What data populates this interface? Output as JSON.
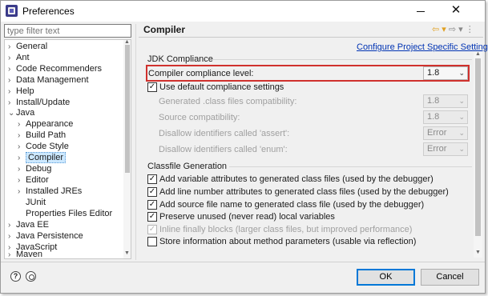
{
  "window": {
    "title": "Preferences",
    "minimize_label": "—",
    "close_label": "✕"
  },
  "filter": {
    "placeholder": "type filter text"
  },
  "tree": {
    "items": [
      {
        "label": "General",
        "chevron": "›"
      },
      {
        "label": "Ant",
        "chevron": "›"
      },
      {
        "label": "Code Recommenders",
        "chevron": "›"
      },
      {
        "label": "Data Management",
        "chevron": "›"
      },
      {
        "label": "Help",
        "chevron": "›"
      },
      {
        "label": "Install/Update",
        "chevron": "›"
      },
      {
        "label": "Java",
        "chevron": "⌄"
      },
      {
        "label": "Appearance",
        "chevron": "›"
      },
      {
        "label": "Build Path",
        "chevron": "›"
      },
      {
        "label": "Code Style",
        "chevron": "›"
      },
      {
        "label": "Compiler",
        "chevron": "›"
      },
      {
        "label": "Debug",
        "chevron": "›"
      },
      {
        "label": "Editor",
        "chevron": "›"
      },
      {
        "label": "Installed JREs",
        "chevron": "›"
      },
      {
        "label": "JUnit",
        "chevron": ""
      },
      {
        "label": "Properties Files Editor",
        "chevron": ""
      },
      {
        "label": "Java EE",
        "chevron": "›"
      },
      {
        "label": "Java Persistence",
        "chevron": "›"
      },
      {
        "label": "JavaScript",
        "chevron": "›"
      },
      {
        "label": "Maven",
        "chevron": "›"
      }
    ],
    "selected": "Compiler"
  },
  "page": {
    "title": "Compiler",
    "nav_back": "⇦ ▾",
    "nav_forward": "⇨ ▾",
    "nav_menu": "⋮",
    "configure_link": "Configure Project Specific Settings..."
  },
  "jdk": {
    "group_label": "JDK Compliance",
    "compliance_label": "Compiler compliance level:",
    "compliance_value": "1.8",
    "use_default_label": "Use default compliance settings",
    "use_default_checked": true,
    "generated_label": "Generated .class files compatibility:",
    "generated_value": "1.8",
    "source_label": "Source compatibility:",
    "source_value": "1.8",
    "assert_label": "Disallow identifiers called 'assert':",
    "assert_value": "Error",
    "enum_label": "Disallow identifiers called 'enum':",
    "enum_value": "Error"
  },
  "classfile": {
    "group_label": "Classfile Generation",
    "options": [
      {
        "label": "Add variable attributes to generated class files (used by the debugger)",
        "checked": true,
        "enabled": true
      },
      {
        "label": "Add line number attributes to generated class files (used by the debugger)",
        "checked": true,
        "enabled": true
      },
      {
        "label": "Add source file name to generated class file (used by the debugger)",
        "checked": true,
        "enabled": true
      },
      {
        "label": "Preserve unused (never read) local variables",
        "checked": true,
        "enabled": true
      },
      {
        "label": "Inline finally blocks (larger class files, but improved performance)",
        "checked": true,
        "enabled": false
      },
      {
        "label": "Store information about method parameters (usable via reflection)",
        "checked": false,
        "enabled": true
      }
    ]
  },
  "buttons": {
    "help": "?",
    "ok": "OK",
    "cancel": "Cancel"
  },
  "colors": {
    "highlight": "#d0312d",
    "link": "#0033b3",
    "selection": "#cce8ff"
  }
}
